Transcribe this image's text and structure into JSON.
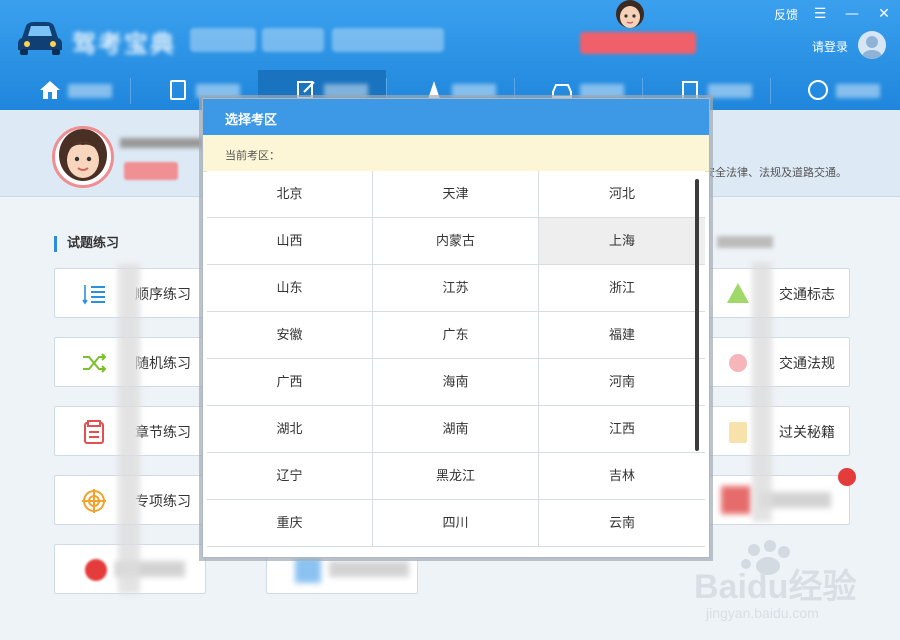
{
  "header": {
    "app_title": "驾考宝典",
    "feedback": "反馈",
    "login": "请登录"
  },
  "profile": {
    "notice": "安全法律、法规及道路交通。"
  },
  "practice": {
    "section_title": "试题练习",
    "cards": [
      {
        "label": "顺序练习",
        "icon": "list-icon"
      },
      {
        "label": "随机练习",
        "icon": "shuffle-icon"
      },
      {
        "label": "章节练习",
        "icon": "notebook-icon"
      },
      {
        "label": "专项练习",
        "icon": "target-icon"
      }
    ]
  },
  "knowledge": {
    "section_title": "知识",
    "cards": [
      {
        "label": "交通标志",
        "icon": "traffic-sign-icon"
      },
      {
        "label": "交通法规",
        "icon": "law-icon"
      },
      {
        "label": "过关秘籍",
        "icon": "book-icon"
      }
    ]
  },
  "dialog": {
    "title": "选择考区",
    "current_label": "当前考区：",
    "regions": [
      "北京",
      "天津",
      "河北",
      "山西",
      "内蒙古",
      "上海",
      "山东",
      "江苏",
      "浙江",
      "安徽",
      "广东",
      "福建",
      "广西",
      "海南",
      "河南",
      "湖北",
      "湖南",
      "江西",
      "辽宁",
      "黑龙江",
      "吉林",
      "重庆",
      "四川",
      "云南"
    ],
    "selected": "上海"
  },
  "watermark": {
    "brand": "Baidu经验",
    "url": "jingyan.baidu.com"
  },
  "colors": {
    "header_blue": "#2b93e6",
    "dialog_header": "#3d99e6",
    "current_bar": "#fcf6d7",
    "accent_red": "#e43b3b"
  }
}
